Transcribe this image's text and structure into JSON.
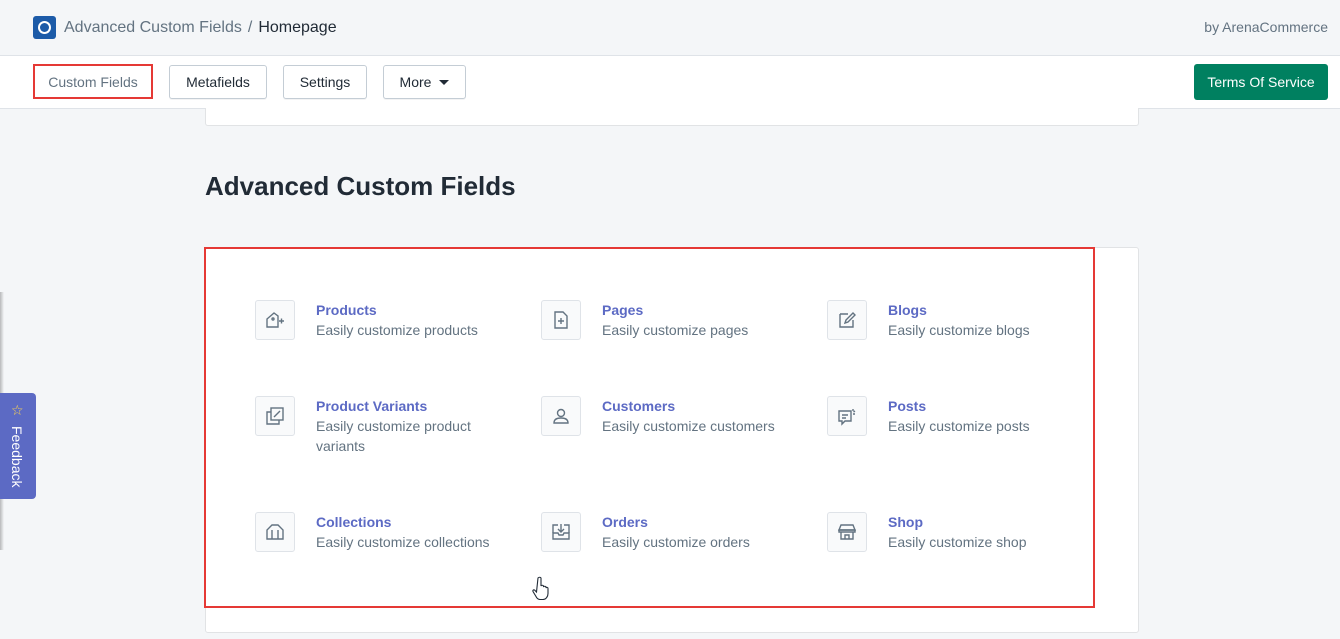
{
  "header": {
    "app_name": "Advanced Custom Fields",
    "separator": "/",
    "page_name": "Homepage",
    "byline": "by ArenaCommerce"
  },
  "toolbar": {
    "tabs": [
      {
        "label": "Custom Fields",
        "active": true
      },
      {
        "label": "Metafields"
      },
      {
        "label": "Settings"
      },
      {
        "label": "More"
      }
    ],
    "cta_label": "Terms Of Service"
  },
  "main": {
    "title": "Advanced Custom Fields",
    "items": [
      {
        "title": "Products",
        "desc": "Easily customize products",
        "icon": "product-icon"
      },
      {
        "title": "Pages",
        "desc": "Easily customize pages",
        "icon": "page-icon"
      },
      {
        "title": "Blogs",
        "desc": "Easily customize blogs",
        "icon": "blog-icon"
      },
      {
        "title": "Product Variants",
        "desc": "Easily customize product variants",
        "icon": "variants-icon"
      },
      {
        "title": "Customers",
        "desc": "Easily customize customers",
        "icon": "customer-icon"
      },
      {
        "title": "Posts",
        "desc": "Easily customize posts",
        "icon": "post-icon"
      },
      {
        "title": "Collections",
        "desc": "Easily customize collections",
        "icon": "collection-icon"
      },
      {
        "title": "Orders",
        "desc": "Easily customize orders",
        "icon": "order-icon"
      },
      {
        "title": "Shop",
        "desc": "Easily customize shop",
        "icon": "shop-icon"
      }
    ]
  },
  "feedback": {
    "label": "Feedback",
    "icon": "star-icon"
  },
  "colors": {
    "accent": "#5c6ac4",
    "primary_button": "#008060",
    "highlight": "#e53935"
  }
}
